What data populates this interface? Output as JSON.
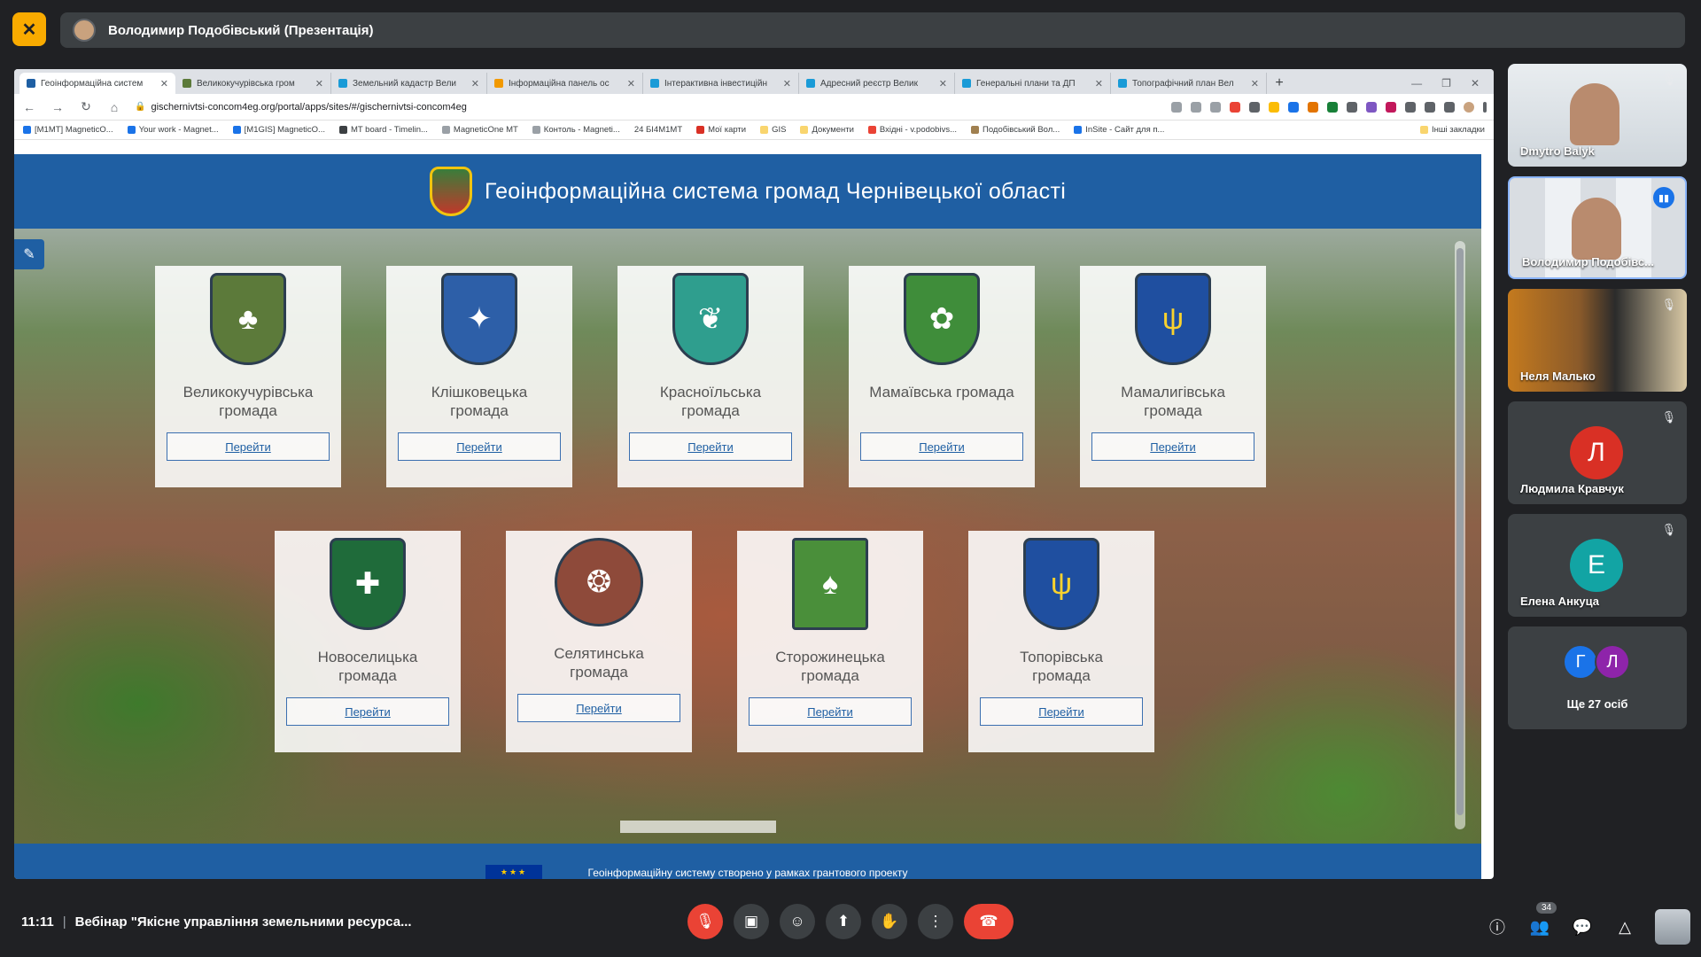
{
  "meet": {
    "presenter_title": "Володимир Подобівський (Презентація)",
    "time": "11:11",
    "meeting_name": "Вебінар \"Якісне управління земельними ресурса...",
    "participant_count": "34"
  },
  "browser": {
    "tabs": [
      {
        "label": "Геоінформаційна систем"
      },
      {
        "label": "Великокучурівська гром"
      },
      {
        "label": "Земельний кадастр Вели"
      },
      {
        "label": "Інформаційна панель ос"
      },
      {
        "label": "Інтерактивна інвестиційн"
      },
      {
        "label": "Адресний реєстр Велик"
      },
      {
        "label": "Генеральні плани та ДП"
      },
      {
        "label": "Топографічний план Вел"
      }
    ],
    "url": "gischernivtsi-concom4eg.org/portal/apps/sites/#/gischernivtsi-concom4eg",
    "bookmarks": [
      "[M1MT] MagneticO...",
      "Your work - Magnet...",
      "[M1GIS] MagneticO...",
      "MT board - Timelin...",
      "MagneticOne MT",
      "Контоль - Magneti...",
      "24  БІ4M1MT",
      "Мої карти",
      "GIS",
      "Документи",
      "Вхідні - v.podobivs...",
      "Подобівський Вол...",
      "InSite - Сайт для п...",
      "Інші закладки"
    ]
  },
  "site": {
    "title": "Геоінформаційна система громад Чернівецької області",
    "footer": "Геоінформаційну систему створено у рамках грантового проекту",
    "eu_stars": "★★★",
    "go_label": "Перейти",
    "communities": [
      {
        "line1": "Великокучурівська",
        "line2": "громада",
        "color": "#5c7a3a",
        "glyph": "♣"
      },
      {
        "line1": "Клішковецька",
        "line2": "громада",
        "color": "#2d5fa8",
        "glyph": "✦"
      },
      {
        "line1": "Красноїльська",
        "line2": "громада",
        "color": "#2f9e8e",
        "glyph": "❦"
      },
      {
        "line1": "Мамаївська громада",
        "line2": "",
        "color": "#3f8d3a",
        "glyph": "✿"
      },
      {
        "line1": "Мамалигівська",
        "line2": "громада",
        "color": "#1f4fa0",
        "glyph": "ψ"
      },
      {
        "line1": "Новоселицька",
        "line2": "громада",
        "color": "#1f6b3a",
        "glyph": "✚"
      },
      {
        "line1": "Селятинська",
        "line2": "громада",
        "color": "#8e4a3a",
        "glyph": "❂"
      },
      {
        "line1": "Сторожинецька",
        "line2": "громада",
        "color": "#4a8f3a",
        "glyph": "♠"
      },
      {
        "line1": "Топорівська",
        "line2": "громада",
        "color": "#1f4fa0",
        "glyph": "ψ"
      }
    ]
  },
  "participants": [
    {
      "name": "Dmytro Balyk"
    },
    {
      "name": "Володимир Подобівс..."
    },
    {
      "name": "Неля Малько"
    },
    {
      "name": "Людмила Кравчук",
      "initial": "Л",
      "color": "#d93025"
    },
    {
      "name": "Елена Анкуца",
      "initial": "Е",
      "color": "#12a4a4"
    }
  ],
  "more": {
    "label": "Ще 27 осіб",
    "initials": [
      {
        "letter": "Г",
        "color": "#1a73e8"
      },
      {
        "letter": "Л",
        "color": "#8e24aa"
      }
    ]
  },
  "icons": {
    "present": "present-off-icon",
    "mic": "mic-off-icon",
    "camera": "camera-icon",
    "emoji": "emoji-icon",
    "share": "present-screen-icon",
    "hand": "raise-hand-icon",
    "more": "more-vert-icon",
    "hangup": "hangup-icon",
    "info": "info-icon",
    "people": "people-icon",
    "chat": "chat-icon",
    "activities": "activities-icon"
  }
}
